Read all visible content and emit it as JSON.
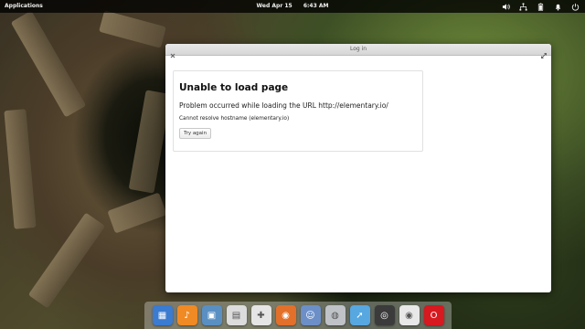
{
  "panel": {
    "applications_label": "Applications",
    "date": "Wed Apr 15",
    "time": "6:43 AM",
    "indicators": [
      "volume-icon",
      "network-icon",
      "battery-icon",
      "notifications-icon",
      "power-icon"
    ]
  },
  "window": {
    "title": "Log in",
    "error": {
      "heading": "Unable to load page",
      "problem_text": "Problem occurred while loading the URL http://elementary.io/",
      "resolve_text": "Cannot resolve hostname (elementary.io)",
      "retry_label": "Try again"
    }
  },
  "dock": {
    "apps": [
      {
        "name": "multitasking-view-icon",
        "color": "#3b7bd0",
        "glyph": "▦"
      },
      {
        "name": "music-icon",
        "color": "#f08a24",
        "glyph": "♪"
      },
      {
        "name": "photos-icon",
        "color": "#5a8fc2",
        "glyph": "▣"
      },
      {
        "name": "calendar-icon",
        "color": "#dcdcdc",
        "glyph": "▤"
      },
      {
        "name": "settings-icon",
        "color": "#e5e5e5",
        "glyph": "✚"
      },
      {
        "name": "firefox-icon",
        "color": "#e2702a",
        "glyph": "◉"
      },
      {
        "name": "finder-icon",
        "color": "#6c8fc7",
        "glyph": "☺"
      },
      {
        "name": "mouse-icon",
        "color": "#bfc3c8",
        "glyph": "◍"
      },
      {
        "name": "cursor-icon",
        "color": "#57a7e0",
        "glyph": "➚"
      },
      {
        "name": "camera-icon",
        "color": "#3b3b3b",
        "glyph": "◎"
      },
      {
        "name": "chrome-icon",
        "color": "#e8e8e8",
        "glyph": "◉"
      },
      {
        "name": "opera-icon",
        "color": "#d71920",
        "glyph": "O"
      }
    ]
  }
}
